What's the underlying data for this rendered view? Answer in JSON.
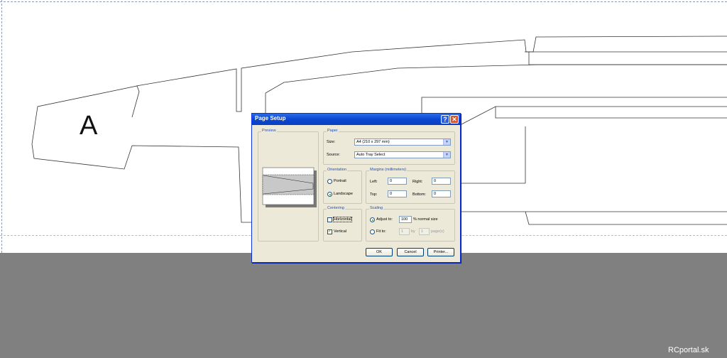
{
  "dialog": {
    "title": "Page Setup",
    "help_glyph": "?",
    "close_glyph": "✕",
    "preview_group": "Preview",
    "paper": {
      "group": "Paper",
      "size_label": "Size:",
      "size_value": "A4 (210 x 297 mm)",
      "source_label": "Source:",
      "source_value": "Auto Tray Select"
    },
    "orientation": {
      "group": "Orientation",
      "portrait": "Portrait",
      "landscape": "Landscape",
      "selected": "landscape"
    },
    "margins": {
      "group": "Margins (millimeters)",
      "left_label": "Left:",
      "left_value": "0",
      "right_label": "Right:",
      "right_value": "0",
      "top_label": "Top:",
      "top_value": "0",
      "bottom_label": "Bottom:",
      "bottom_value": "0"
    },
    "centering": {
      "group": "Centering",
      "horizontal": "Horizontal",
      "horizontal_checked": false,
      "vertical": "Vertical",
      "vertical_checked": true
    },
    "scaling": {
      "group": "Scaling",
      "adjust_label": "Adjust to:",
      "adjust_value": "100",
      "adjust_suffix": "% normal size",
      "fit_label": "Fit to:",
      "fit_wide_value": "1",
      "fit_by": "by",
      "fit_tall_value": "1",
      "fit_suffix": "page(s)"
    },
    "buttons": {
      "ok": "OK",
      "cancel": "Cancel",
      "printer": "Printer..."
    }
  },
  "canvas": {
    "part_label": "A"
  },
  "watermark": "RCportal.sk",
  "colors": {
    "titlebar": "#0a47d0",
    "dialog_bg": "#ece9d8",
    "workspace": "#808080"
  }
}
